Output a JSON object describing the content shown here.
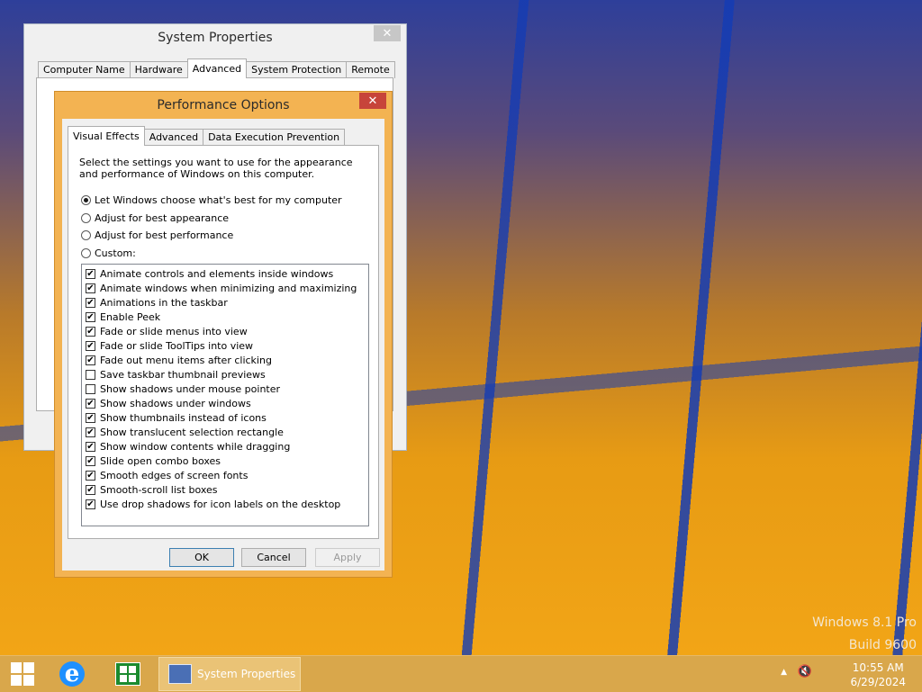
{
  "desktop": {
    "watermark_line1": "Windows 8.1 Pro",
    "watermark_line2": "Build 9600"
  },
  "system_properties": {
    "title": "System Properties",
    "close_label": "✕",
    "tabs": [
      "Computer Name",
      "Hardware",
      "Advanced",
      "System Protection",
      "Remote"
    ],
    "active_tab": "Advanced"
  },
  "performance_options": {
    "title": "Performance Options",
    "close_label": "✕",
    "tabs": [
      "Visual Effects",
      "Advanced",
      "Data Execution Prevention"
    ],
    "active_tab": "Visual Effects",
    "description": "Select the settings you want to use for the appearance and performance of Windows on this computer.",
    "radio_options": [
      {
        "label": "Let Windows choose what's best for my computer",
        "selected": true
      },
      {
        "label": "Adjust for best appearance",
        "selected": false
      },
      {
        "label": "Adjust for best performance",
        "selected": false
      },
      {
        "label": "Custom:",
        "selected": false
      }
    ],
    "effects": [
      {
        "label": "Animate controls and elements inside windows",
        "checked": true
      },
      {
        "label": "Animate windows when minimizing and maximizing",
        "checked": true
      },
      {
        "label": "Animations in the taskbar",
        "checked": true
      },
      {
        "label": "Enable Peek",
        "checked": true
      },
      {
        "label": "Fade or slide menus into view",
        "checked": true
      },
      {
        "label": "Fade or slide ToolTips into view",
        "checked": true
      },
      {
        "label": "Fade out menu items after clicking",
        "checked": true
      },
      {
        "label": "Save taskbar thumbnail previews",
        "checked": false
      },
      {
        "label": "Show shadows under mouse pointer",
        "checked": false
      },
      {
        "label": "Show shadows under windows",
        "checked": true
      },
      {
        "label": "Show thumbnails instead of icons",
        "checked": true
      },
      {
        "label": "Show translucent selection rectangle",
        "checked": true
      },
      {
        "label": "Show window contents while dragging",
        "checked": true
      },
      {
        "label": "Slide open combo boxes",
        "checked": true
      },
      {
        "label": "Smooth edges of screen fonts",
        "checked": true
      },
      {
        "label": "Smooth-scroll list boxes",
        "checked": true
      },
      {
        "label": "Use drop shadows for icon labels on the desktop",
        "checked": true
      }
    ],
    "buttons": {
      "ok": "OK",
      "cancel": "Cancel",
      "apply": "Apply"
    }
  },
  "taskbar": {
    "start_icon": "windows-logo-icon",
    "pinned": [
      "internet-explorer-icon",
      "store-icon"
    ],
    "active_task_label": "System Properties",
    "tray_icons": [
      "show-hidden-icons-arrow-icon",
      "speaker-muted-icon"
    ],
    "show_hidden_glyph": "▲",
    "speaker_glyph": "🔇",
    "ie_glyph": "e",
    "clock_time": "10:55 AM",
    "clock_date": "6/29/2024"
  }
}
